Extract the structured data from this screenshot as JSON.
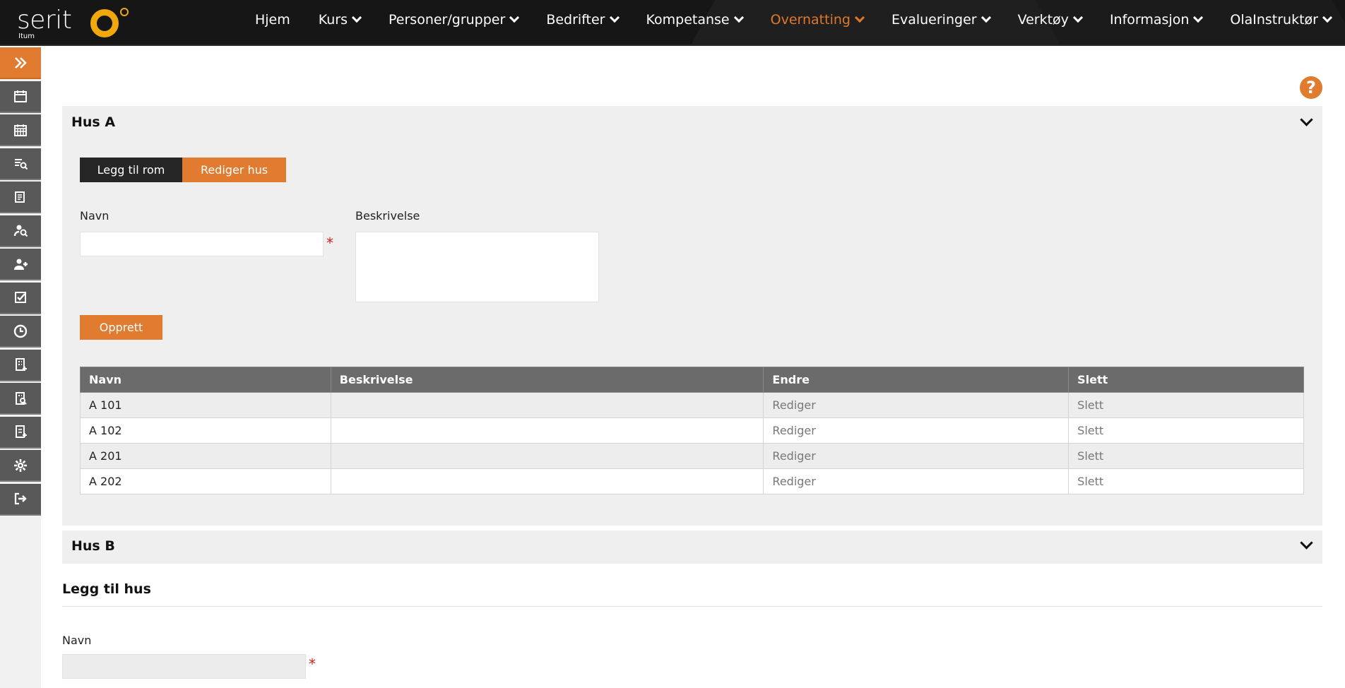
{
  "brand": {
    "name": "serit",
    "sub": "Itum"
  },
  "nav": [
    {
      "label": "Hjem",
      "chevron": false,
      "active": false
    },
    {
      "label": "Kurs",
      "chevron": true,
      "active": false
    },
    {
      "label": "Personer/grupper",
      "chevron": true,
      "active": false
    },
    {
      "label": "Bedrifter",
      "chevron": true,
      "active": false
    },
    {
      "label": "Kompetanse",
      "chevron": true,
      "active": false
    },
    {
      "label": "Overnatting",
      "chevron": true,
      "active": true
    },
    {
      "label": "Evalueringer",
      "chevron": true,
      "active": false
    },
    {
      "label": "Verktøy",
      "chevron": true,
      "active": false
    },
    {
      "label": "Informasjon",
      "chevron": true,
      "active": false
    },
    {
      "label": "OlaInstruktør",
      "chevron": true,
      "active": false
    }
  ],
  "sidebar": [
    "expand-icon",
    "calendar-icon",
    "calendar-grid-icon",
    "course-search-icon",
    "course-edit-icon",
    "person-search-icon",
    "add-person-icon",
    "checklist-icon",
    "clock-icon",
    "building-add-icon",
    "building-search-icon",
    "document-add-icon",
    "gear-icon",
    "logout-icon"
  ],
  "help_label": "?",
  "colors": {
    "accent": "#e07b30",
    "topbar": "#161616",
    "sidebar_btn": "#595959"
  },
  "hus_a": {
    "title": "Hus A",
    "add_room_label": "Legg til rom",
    "edit_house_label": "Rediger hus",
    "name_label": "Navn",
    "description_label": "Beskrivelse",
    "required_mark": "*",
    "name_value": "",
    "description_value": "",
    "create_label": "Opprett",
    "table": {
      "headers": [
        "Navn",
        "Beskrivelse",
        "Endre",
        "Slett"
      ],
      "rows": [
        {
          "name": "A 101",
          "description": "",
          "edit": "Rediger",
          "delete": "Slett"
        },
        {
          "name": "A 102",
          "description": "",
          "edit": "Rediger",
          "delete": "Slett"
        },
        {
          "name": "A 201",
          "description": "",
          "edit": "Rediger",
          "delete": "Slett"
        },
        {
          "name": "A 202",
          "description": "",
          "edit": "Rediger",
          "delete": "Slett"
        }
      ]
    }
  },
  "hus_b": {
    "title": "Hus B"
  },
  "add_house": {
    "title": "Legg til hus",
    "name_label": "Navn",
    "required_mark": "*",
    "name_value": ""
  }
}
